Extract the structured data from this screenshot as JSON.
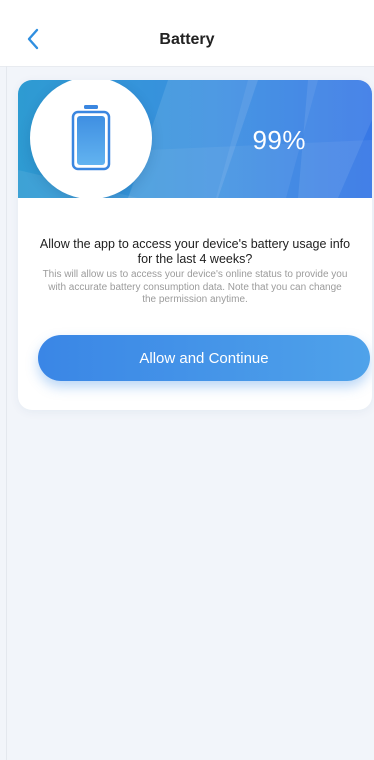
{
  "header": {
    "title": "Battery",
    "back_icon": "chevron-left-icon"
  },
  "banner": {
    "battery_icon": "battery-icon",
    "percent": "99%"
  },
  "permission": {
    "main_text": "Allow the app to access your device's battery usage info for the last 4 weeks?",
    "sub_text": "This will allow us to access your device's online status to provide you with accurate battery consumption data. Note that you can change the permission anytime."
  },
  "actions": {
    "allow_label": "Allow and Continue"
  },
  "colors": {
    "accent": "#3a86e6",
    "back_icon": "#2f8fe0",
    "background": "#f2f5fa"
  }
}
